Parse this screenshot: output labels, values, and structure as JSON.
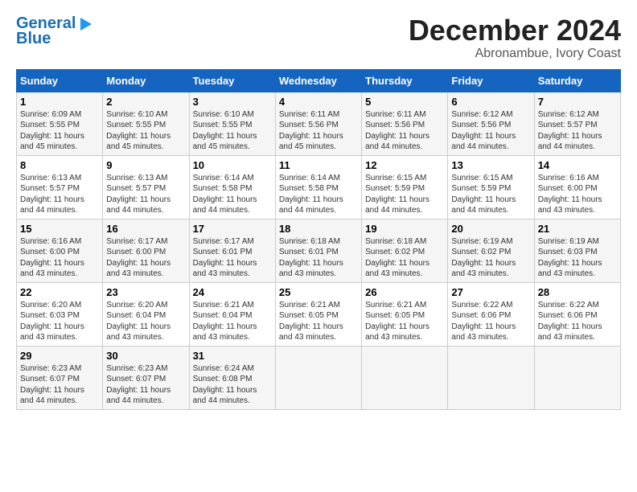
{
  "logo": {
    "line1": "General",
    "line2": "Blue"
  },
  "title": "December 2024",
  "subtitle": "Abronambue, Ivory Coast",
  "weekdays": [
    "Sunday",
    "Monday",
    "Tuesday",
    "Wednesday",
    "Thursday",
    "Friday",
    "Saturday"
  ],
  "weeks": [
    [
      {
        "day": "1",
        "info": "Sunrise: 6:09 AM\nSunset: 5:55 PM\nDaylight: 11 hours\nand 45 minutes."
      },
      {
        "day": "2",
        "info": "Sunrise: 6:10 AM\nSunset: 5:55 PM\nDaylight: 11 hours\nand 45 minutes."
      },
      {
        "day": "3",
        "info": "Sunrise: 6:10 AM\nSunset: 5:55 PM\nDaylight: 11 hours\nand 45 minutes."
      },
      {
        "day": "4",
        "info": "Sunrise: 6:11 AM\nSunset: 5:56 PM\nDaylight: 11 hours\nand 45 minutes."
      },
      {
        "day": "5",
        "info": "Sunrise: 6:11 AM\nSunset: 5:56 PM\nDaylight: 11 hours\nand 44 minutes."
      },
      {
        "day": "6",
        "info": "Sunrise: 6:12 AM\nSunset: 5:56 PM\nDaylight: 11 hours\nand 44 minutes."
      },
      {
        "day": "7",
        "info": "Sunrise: 6:12 AM\nSunset: 5:57 PM\nDaylight: 11 hours\nand 44 minutes."
      }
    ],
    [
      {
        "day": "8",
        "info": "Sunrise: 6:13 AM\nSunset: 5:57 PM\nDaylight: 11 hours\nand 44 minutes."
      },
      {
        "day": "9",
        "info": "Sunrise: 6:13 AM\nSunset: 5:57 PM\nDaylight: 11 hours\nand 44 minutes."
      },
      {
        "day": "10",
        "info": "Sunrise: 6:14 AM\nSunset: 5:58 PM\nDaylight: 11 hours\nand 44 minutes."
      },
      {
        "day": "11",
        "info": "Sunrise: 6:14 AM\nSunset: 5:58 PM\nDaylight: 11 hours\nand 44 minutes."
      },
      {
        "day": "12",
        "info": "Sunrise: 6:15 AM\nSunset: 5:59 PM\nDaylight: 11 hours\nand 44 minutes."
      },
      {
        "day": "13",
        "info": "Sunrise: 6:15 AM\nSunset: 5:59 PM\nDaylight: 11 hours\nand 44 minutes."
      },
      {
        "day": "14",
        "info": "Sunrise: 6:16 AM\nSunset: 6:00 PM\nDaylight: 11 hours\nand 43 minutes."
      }
    ],
    [
      {
        "day": "15",
        "info": "Sunrise: 6:16 AM\nSunset: 6:00 PM\nDaylight: 11 hours\nand 43 minutes."
      },
      {
        "day": "16",
        "info": "Sunrise: 6:17 AM\nSunset: 6:00 PM\nDaylight: 11 hours\nand 43 minutes."
      },
      {
        "day": "17",
        "info": "Sunrise: 6:17 AM\nSunset: 6:01 PM\nDaylight: 11 hours\nand 43 minutes."
      },
      {
        "day": "18",
        "info": "Sunrise: 6:18 AM\nSunset: 6:01 PM\nDaylight: 11 hours\nand 43 minutes."
      },
      {
        "day": "19",
        "info": "Sunrise: 6:18 AM\nSunset: 6:02 PM\nDaylight: 11 hours\nand 43 minutes."
      },
      {
        "day": "20",
        "info": "Sunrise: 6:19 AM\nSunset: 6:02 PM\nDaylight: 11 hours\nand 43 minutes."
      },
      {
        "day": "21",
        "info": "Sunrise: 6:19 AM\nSunset: 6:03 PM\nDaylight: 11 hours\nand 43 minutes."
      }
    ],
    [
      {
        "day": "22",
        "info": "Sunrise: 6:20 AM\nSunset: 6:03 PM\nDaylight: 11 hours\nand 43 minutes."
      },
      {
        "day": "23",
        "info": "Sunrise: 6:20 AM\nSunset: 6:04 PM\nDaylight: 11 hours\nand 43 minutes."
      },
      {
        "day": "24",
        "info": "Sunrise: 6:21 AM\nSunset: 6:04 PM\nDaylight: 11 hours\nand 43 minutes."
      },
      {
        "day": "25",
        "info": "Sunrise: 6:21 AM\nSunset: 6:05 PM\nDaylight: 11 hours\nand 43 minutes."
      },
      {
        "day": "26",
        "info": "Sunrise: 6:21 AM\nSunset: 6:05 PM\nDaylight: 11 hours\nand 43 minutes."
      },
      {
        "day": "27",
        "info": "Sunrise: 6:22 AM\nSunset: 6:06 PM\nDaylight: 11 hours\nand 43 minutes."
      },
      {
        "day": "28",
        "info": "Sunrise: 6:22 AM\nSunset: 6:06 PM\nDaylight: 11 hours\nand 43 minutes."
      }
    ],
    [
      {
        "day": "29",
        "info": "Sunrise: 6:23 AM\nSunset: 6:07 PM\nDaylight: 11 hours\nand 44 minutes."
      },
      {
        "day": "30",
        "info": "Sunrise: 6:23 AM\nSunset: 6:07 PM\nDaylight: 11 hours\nand 44 minutes."
      },
      {
        "day": "31",
        "info": "Sunrise: 6:24 AM\nSunset: 6:08 PM\nDaylight: 11 hours\nand 44 minutes."
      },
      {
        "day": "",
        "info": ""
      },
      {
        "day": "",
        "info": ""
      },
      {
        "day": "",
        "info": ""
      },
      {
        "day": "",
        "info": ""
      }
    ]
  ]
}
